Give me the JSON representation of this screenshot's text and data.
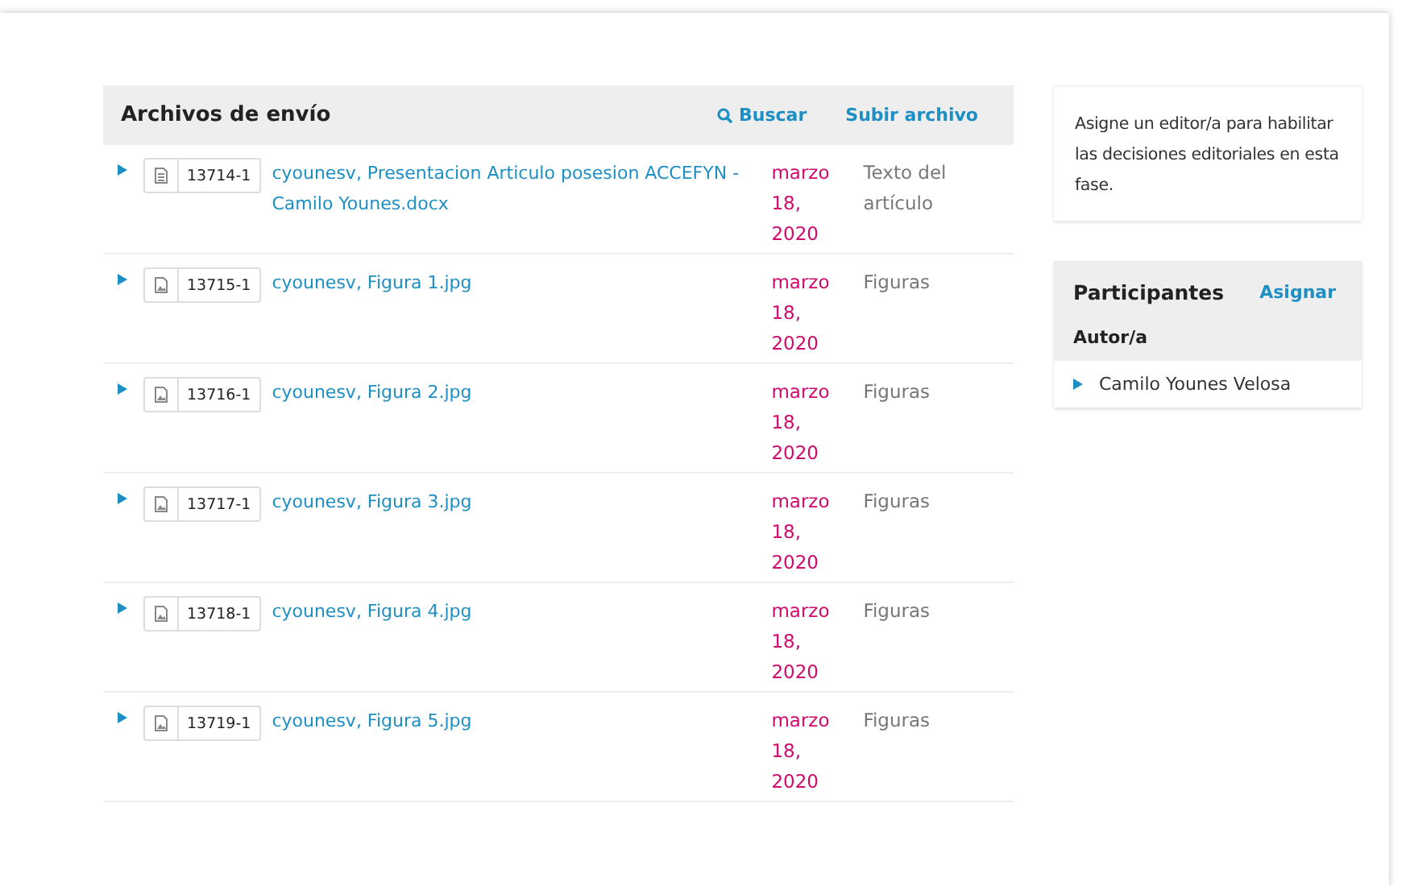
{
  "files_panel": {
    "title": "Archivos de envío",
    "search_label": "Buscar",
    "upload_label": "Subir archivo",
    "rows": [
      {
        "id": "13714-1",
        "kind": "document",
        "name": "cyounesv, Presentacion Articulo posesion ACCEFYN - Camilo Younes.docx",
        "date": "marzo 18, 2020",
        "type": "Texto del artículo"
      },
      {
        "id": "13715-1",
        "kind": "image",
        "name": "cyounesv, Figura 1.jpg",
        "date": "marzo 18, 2020",
        "type": "Figuras"
      },
      {
        "id": "13716-1",
        "kind": "image",
        "name": "cyounesv, Figura 2.jpg",
        "date": "marzo 18, 2020",
        "type": "Figuras"
      },
      {
        "id": "13717-1",
        "kind": "image",
        "name": "cyounesv, Figura 3.jpg",
        "date": "marzo 18, 2020",
        "type": "Figuras"
      },
      {
        "id": "13718-1",
        "kind": "image",
        "name": "cyounesv, Figura 4.jpg",
        "date": "marzo 18, 2020",
        "type": "Figuras"
      },
      {
        "id": "13719-1",
        "kind": "image",
        "name": "cyounesv, Figura 5.jpg",
        "date": "marzo 18, 2020",
        "type": "Figuras"
      }
    ]
  },
  "notice": "Asigne un editor/a para habilitar las decisiones editoriales en esta fase.",
  "participants": {
    "title": "Participantes",
    "assign_label": "Asignar",
    "groups": [
      {
        "label": "Autor/a",
        "members": [
          "Camilo Younes Velosa"
        ]
      }
    ]
  }
}
